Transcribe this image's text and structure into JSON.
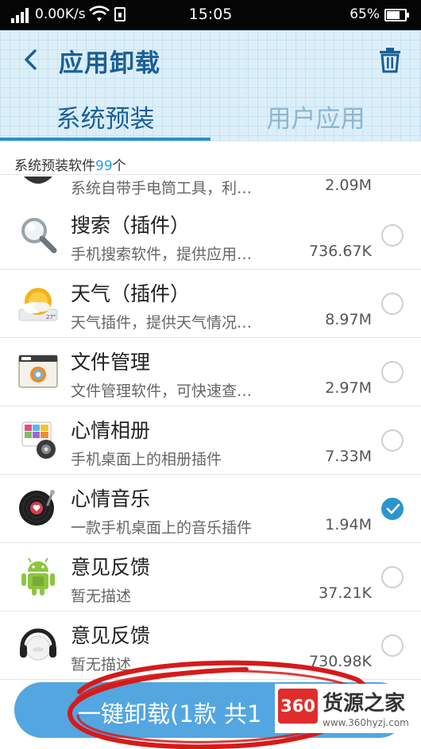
{
  "status_bar": {
    "speed": "0.00K/s",
    "time": "15:05",
    "battery": "65%"
  },
  "header": {
    "title": "应用卸载",
    "tabs": [
      {
        "label": "系统预装",
        "active": true
      },
      {
        "label": "用户应用",
        "active": false
      }
    ]
  },
  "subheader": {
    "label": "系统预装软件",
    "count": "99",
    "suffix": "个"
  },
  "apps": [
    {
      "name": "",
      "desc": "系统自带手电筒工具，利…",
      "size": "2.09M",
      "selected": false,
      "icon": "flashlight-icon"
    },
    {
      "name": "搜索（插件）",
      "desc": "手机搜索软件，提供应用…",
      "size": "736.67K",
      "selected": false,
      "icon": "magnifier-icon"
    },
    {
      "name": "天气（插件）",
      "desc": "天气插件，提供天气情况…",
      "size": "8.97M",
      "selected": false,
      "icon": "weather-sun-icon"
    },
    {
      "name": "文件管理",
      "desc": "文件管理软件，可快速查…",
      "size": "2.97M",
      "selected": false,
      "icon": "file-manager-icon"
    },
    {
      "name": "心情相册",
      "desc": "手机桌面上的相册插件",
      "size": "7.33M",
      "selected": false,
      "icon": "photo-album-icon"
    },
    {
      "name": "心情音乐",
      "desc": "一款手机桌面上的音乐插件",
      "size": "1.94M",
      "selected": true,
      "icon": "music-record-icon"
    },
    {
      "name": "意见反馈",
      "desc": "暂无描述",
      "size": "37.21K",
      "selected": false,
      "icon": "android-robot-icon"
    },
    {
      "name": "意见反馈",
      "desc": "暂无描述",
      "size": "730.98K",
      "selected": false,
      "icon": "headset-icon"
    }
  ],
  "uninstall_button": {
    "label": "一键卸载(1款 共1"
  },
  "watermark": {
    "logo": "360",
    "name": "货源之家",
    "url": "www.360hyzj.com"
  },
  "colors": {
    "accent": "#2a8fd0",
    "title": "#1b5f97",
    "button": "#53a6e0",
    "annotation": "#d61a1a"
  }
}
